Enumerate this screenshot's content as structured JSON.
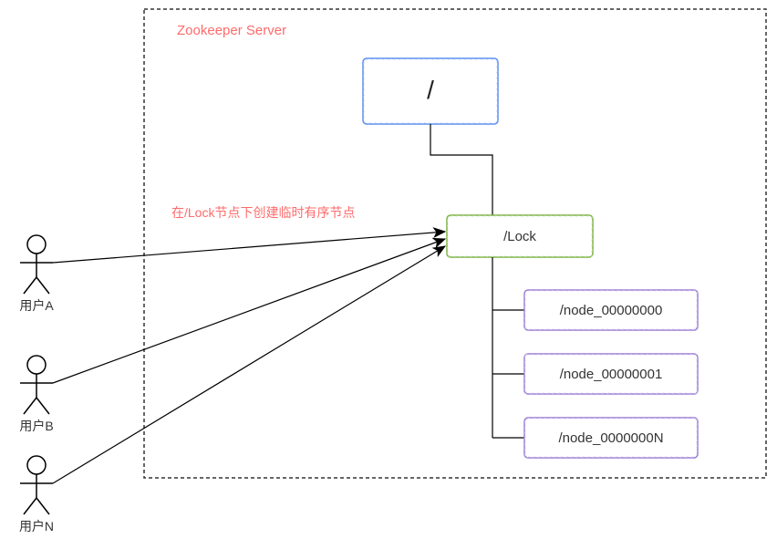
{
  "server": {
    "title": "Zookeeper Server"
  },
  "annotation": {
    "text": "在/Lock节点下创建临时有序节点"
  },
  "tree": {
    "root": {
      "label": "/"
    },
    "lock": {
      "label": "/Lock"
    },
    "children": [
      {
        "label": "/node_00000000"
      },
      {
        "label": "/node_00000001"
      },
      {
        "label": "/node_0000000N"
      }
    ]
  },
  "actors": [
    {
      "label": "用户A"
    },
    {
      "label": "用户B"
    },
    {
      "label": "用户N"
    }
  ]
}
